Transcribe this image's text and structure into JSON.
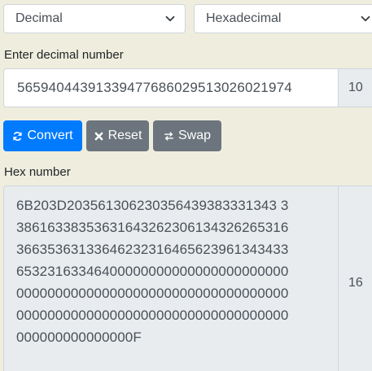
{
  "converter": {
    "from_select": {
      "selected": "Decimal"
    },
    "to_select": {
      "selected": "Hexadecimal"
    },
    "input_label": "Enter decimal number",
    "input_value": "56594044391339477686029513026021974",
    "input_base": "10",
    "buttons": {
      "convert": "Convert",
      "reset": "Reset",
      "swap": "Swap"
    },
    "output_label": "Hex number",
    "output_lines": [
      "6B203D203561306230356439383331343 3",
      "38616338353631643262306134326265316",
      "36635363133646232316465623961343433",
      "65323163346400000000000000000000000",
      "00000000000000000000000000000000000",
      "00000000000000000000000000000000000",
      "000000000000000F"
    ],
    "output_base": "16"
  },
  "colors": {
    "background": "#efeede",
    "primary": "#007bff",
    "secondary": "#6c757d"
  }
}
